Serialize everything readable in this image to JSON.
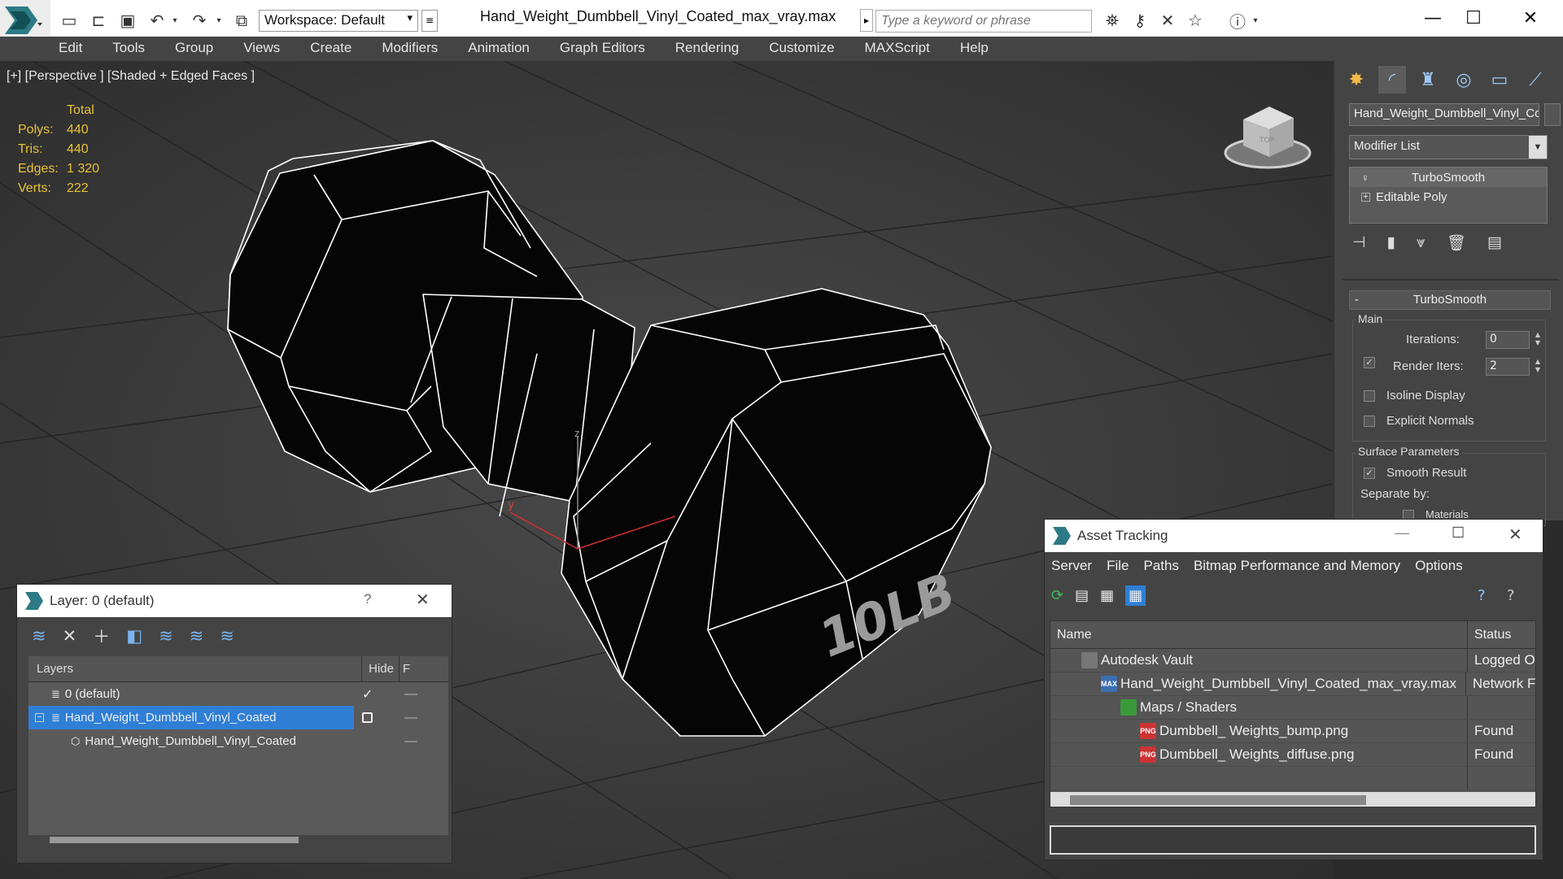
{
  "titlebar": {
    "workspace": "Workspace: Default",
    "document_title": "Hand_Weight_Dumbbell_Vinyl_Coated_max_vray.max",
    "search_placeholder": "Type a keyword or phrase"
  },
  "menubar": [
    "Edit",
    "Tools",
    "Group",
    "Views",
    "Create",
    "Modifiers",
    "Animation",
    "Graph Editors",
    "Rendering",
    "Customize",
    "MAXScript",
    "Help"
  ],
  "viewport": {
    "label": "[+] [Perspective ] [Shaded + Edged Faces ]",
    "stats": {
      "header": "Total",
      "rows": [
        {
          "key": "Polys:",
          "value": "440"
        },
        {
          "key": "Tris:",
          "value": "440"
        },
        {
          "key": "Edges:",
          "value": "1 320"
        },
        {
          "key": "Verts:",
          "value": "222"
        }
      ]
    },
    "engraving": "10LB",
    "axis_labels": {
      "z": "z",
      "y": "y"
    },
    "viewcube_label": "TOP"
  },
  "layer_dialog": {
    "title": "Layer: 0 (default)",
    "help": "?",
    "columns": {
      "layers": "Layers",
      "hide": "Hide",
      "freeze": "F"
    },
    "rows": [
      {
        "name": "0 (default)",
        "level": 0
      },
      {
        "name": "Hand_Weight_Dumbbell_Vinyl_Coated",
        "level": 0,
        "selected": true
      },
      {
        "name": "Hand_Weight_Dumbbell_Vinyl_Coated",
        "level": 1
      }
    ]
  },
  "command_panel": {
    "object_name": "Hand_Weight_Dumbbell_Vinyl_Coated",
    "modifier_list": "Modifier List",
    "stack": [
      "TurboSmooth",
      "Editable Poly"
    ],
    "rollout": {
      "title": "TurboSmooth",
      "collapse": "-",
      "main_group": "Main",
      "iterations_label": "Iterations:",
      "iterations": "0",
      "render_iters_label": "Render Iters:",
      "render_iters": "2",
      "render_iters_checked": true,
      "isoline_label": "Isoline Display",
      "explicit_label": "Explicit Normals",
      "surface_group": "Surface Parameters",
      "smooth_label": "Smooth Result",
      "smooth_checked": true,
      "separate_label": "Separate by:",
      "materials_label": "Materials"
    }
  },
  "asset_tracking": {
    "title": "Asset Tracking",
    "menu": [
      "Server",
      "File",
      "Paths",
      "Bitmap Performance and Memory",
      "Options"
    ],
    "columns": {
      "name": "Name",
      "status": "Status"
    },
    "rows": [
      {
        "name": "Autodesk Vault",
        "status": "Logged O",
        "level": 1,
        "icon": "vault-icon",
        "icon_text": ""
      },
      {
        "name": "Hand_Weight_Dumbbell_Vinyl_Coated_max_vray.max",
        "status": "Network F",
        "level": 2,
        "icon": "max-file-icon",
        "icon_text": "MAX"
      },
      {
        "name": "Maps / Shaders",
        "status": "",
        "level": 3,
        "icon": "maps-icon",
        "icon_text": ""
      },
      {
        "name": "Dumbbell_ Weights_bump.png",
        "status": "Found",
        "level": 4,
        "icon": "png-file-icon",
        "icon_text": "PNG"
      },
      {
        "name": "Dumbbell_ Weights_diffuse.png",
        "status": "Found",
        "level": 4,
        "icon": "png-file-icon",
        "icon_text": "PNG"
      }
    ]
  }
}
